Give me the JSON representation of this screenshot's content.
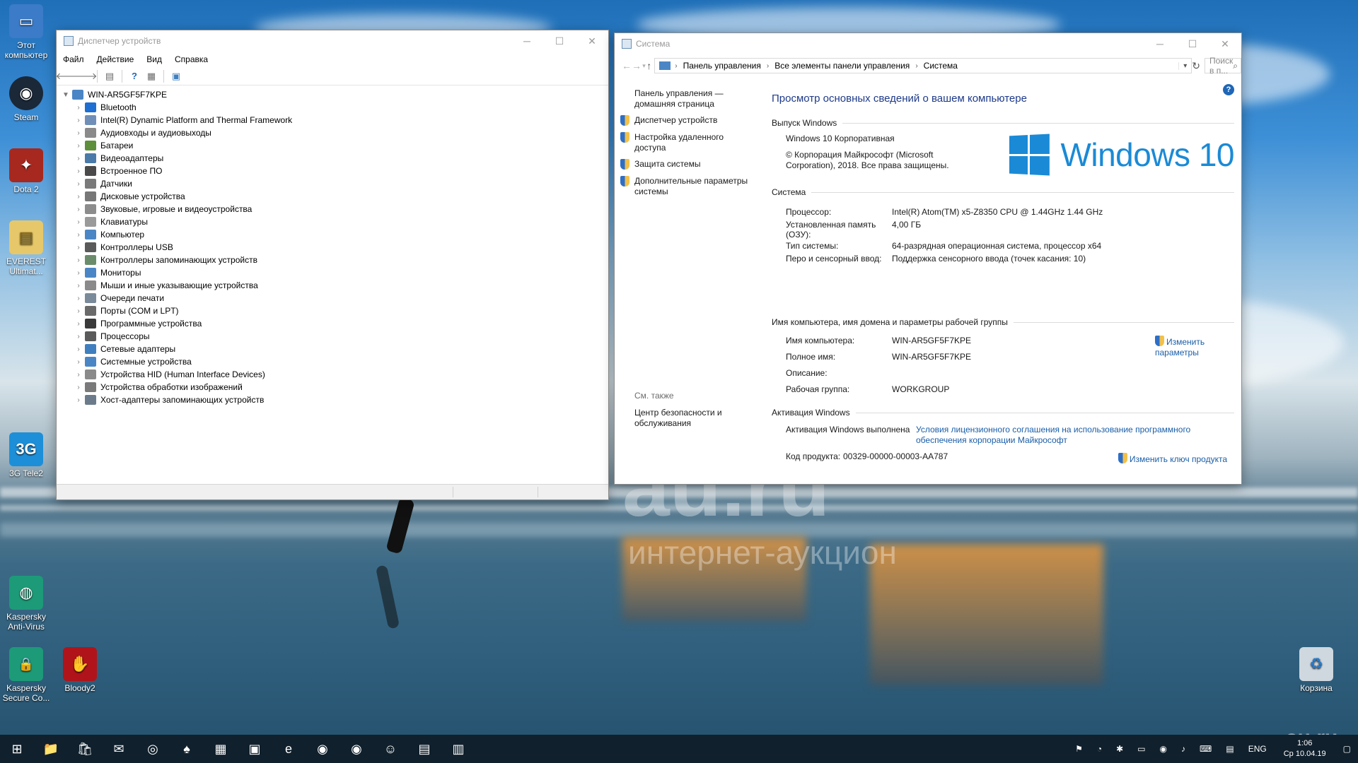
{
  "desktop": {
    "icons": [
      {
        "label": "Этот компьютер",
        "color": "#3b7bc8",
        "glyph": "▭"
      },
      {
        "label": "Steam",
        "color": "#1b2838",
        "glyph": "◉"
      },
      {
        "label": "Dota 2",
        "color": "#a7281e",
        "glyph": "✦"
      },
      {
        "label": "EVEREST Ultimat...",
        "color": "#e6c86a",
        "glyph": "▤"
      },
      {
        "label": "3G Tele2",
        "color": "#1d8fd8",
        "glyph": "3G"
      },
      {
        "label": "Kaspersky Anti-Virus",
        "color": "#1d9a78",
        "glyph": "◍"
      },
      {
        "label": "Kaspersky Secure Co...",
        "color": "#1d9a78",
        "glyph": "🔒"
      },
      {
        "label": "Bloody2",
        "color": "#b0141a",
        "glyph": "✋"
      },
      {
        "label": "Корзина",
        "color": "#cfd8df",
        "glyph": "♻"
      }
    ],
    "watermark_main": "au.ru",
    "watermark_sub": "интернет-аукцион",
    "watermark_corner": "au.ru"
  },
  "devmgr": {
    "title": "Диспетчер устройств",
    "menu": [
      "Файл",
      "Действие",
      "Вид",
      "Справка"
    ],
    "root": "WIN-AR5GF5F7KPE",
    "items": [
      {
        "label": "Bluetooth",
        "color": "#1e6fd1"
      },
      {
        "label": "Intel(R) Dynamic Platform and Thermal Framework",
        "color": "#6f8fb8"
      },
      {
        "label": "Аудиовходы и аудиовыходы",
        "color": "#8a8a8a"
      },
      {
        "label": "Батареи",
        "color": "#5e8f3a"
      },
      {
        "label": "Видеоадаптеры",
        "color": "#4a7aa8"
      },
      {
        "label": "Встроенное ПО",
        "color": "#4a4a4a"
      },
      {
        "label": "Датчики",
        "color": "#7a7a7a"
      },
      {
        "label": "Дисковые устройства",
        "color": "#777777"
      },
      {
        "label": "Звуковые, игровые и видеоустройства",
        "color": "#8c8c8c"
      },
      {
        "label": "Клавиатуры",
        "color": "#9a9a9a"
      },
      {
        "label": "Компьютер",
        "color": "#4a86c5"
      },
      {
        "label": "Контроллеры USB",
        "color": "#5a5a5a"
      },
      {
        "label": "Контроллеры запоминающих устройств",
        "color": "#6b8c6b"
      },
      {
        "label": "Мониторы",
        "color": "#4a86c5"
      },
      {
        "label": "Мыши и иные указывающие устройства",
        "color": "#8a8a8a"
      },
      {
        "label": "Очереди печати",
        "color": "#7a8a9a"
      },
      {
        "label": "Порты (COM и LPT)",
        "color": "#6a6a6a"
      },
      {
        "label": "Программные устройства",
        "color": "#3a3a3a"
      },
      {
        "label": "Процессоры",
        "color": "#5a5a5a"
      },
      {
        "label": "Сетевые адаптеры",
        "color": "#3f7fbf"
      },
      {
        "label": "Системные устройства",
        "color": "#4a86c5"
      },
      {
        "label": "Устройства HID (Human Interface Devices)",
        "color": "#8a8a8a"
      },
      {
        "label": "Устройства обработки изображений",
        "color": "#7a7a7a"
      },
      {
        "label": "Хост-адаптеры запоминающих устройств",
        "color": "#6b7b8b"
      }
    ]
  },
  "system": {
    "title": "Система",
    "breadcrumbs": [
      "Панель управления",
      "Все элементы панели управления",
      "Система"
    ],
    "search_placeholder": "Поиск в п...",
    "left": {
      "home": "Панель управления — домашняя страница",
      "links": [
        "Диспетчер устройств",
        "Настройка удаленного доступа",
        "Защита системы",
        "Дополнительные параметры системы"
      ],
      "see_also": "См. также",
      "security_center": "Центр безопасности и обслуживания"
    },
    "heading": "Просмотр основных сведений о вашем компьютере",
    "edition_section": "Выпуск Windows",
    "edition": "Windows 10 Корпоративная",
    "copyright": "© Корпорация Майкрософт (Microsoft Corporation), 2018. Все права защищены.",
    "logo_text": "Windows 10",
    "system_section": "Система",
    "system_rows": [
      {
        "label": "Процессор:",
        "value": "Intel(R) Atom(TM) x5-Z8350  CPU @ 1.44GHz   1.44 GHz"
      },
      {
        "label": "Установленная память (ОЗУ):",
        "value": "4,00 ГБ"
      },
      {
        "label": "Тип системы:",
        "value": "64-разрядная операционная система, процессор x64"
      },
      {
        "label": "Перо и сенсорный ввод:",
        "value": "Поддержка сенсорного ввода (точек касания: 10)"
      }
    ],
    "name_section": "Имя компьютера, имя домена и параметры рабочей группы",
    "name_rows": [
      {
        "label": "Имя компьютера:",
        "value": "WIN-AR5GF5F7KPE"
      },
      {
        "label": "Полное имя:",
        "value": "WIN-AR5GF5F7KPE"
      },
      {
        "label": "Описание:",
        "value": ""
      },
      {
        "label": "Рабочая группа:",
        "value": "WORKGROUP"
      }
    ],
    "change_params": "Изменить параметры",
    "activation_section": "Активация Windows",
    "activation_status": "Активация Windows выполнена",
    "license_link": "Условия лицензионного соглашения на использование программного обеспечения корпорации Майкрософт",
    "product_key_label": "Код продукта:",
    "product_key": "00329-00000-00003-AA787",
    "change_key": "Изменить ключ продукта"
  },
  "taskbar": {
    "apps": [
      "⊞",
      "📁",
      "🛍",
      "✉",
      "◎",
      "♠",
      "▦",
      "▣",
      "e",
      "◉",
      "◉",
      "☺",
      "▤",
      "▥"
    ],
    "lang": "ENG",
    "time": "1:06",
    "date": "Ср 10.04.19"
  }
}
